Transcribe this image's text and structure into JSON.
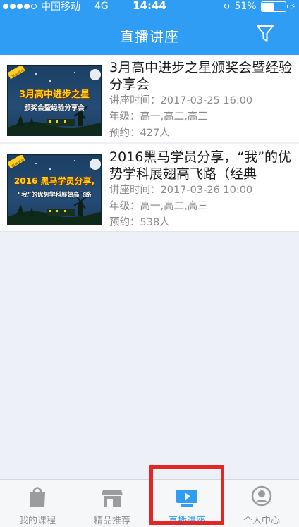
{
  "status": {
    "carrier": "中国移动",
    "network": "4G",
    "time": "14:44",
    "battery": "51%",
    "battery_level": 0.51
  },
  "header": {
    "title": "直播讲座"
  },
  "lectures": [
    {
      "title": "3月高中进步之星颁奖会暨经验分享会",
      "time": "讲座时间：2017-03-25 16:00",
      "grade": "年级：高一,高二,高三",
      "booked": "预约：427人",
      "thumb": {
        "tag": "高中学员",
        "line1": "3月高中进步之星",
        "line2": "颁奖会暨经验分享会"
      }
    },
    {
      "title": "2016黑马学员分享，“我”的优势学科展翅高飞路（经典",
      "time": "讲座时间：2017-03-26 10:00",
      "grade": "年级：高一,高二,高三",
      "booked": "预约：538人",
      "thumb": {
        "tag": "高中学员",
        "line1": "2016 黑马学员分享,",
        "line2": "“我”的优势学科展翅高飞路"
      }
    }
  ],
  "tabs": [
    {
      "label": "我的课程",
      "icon": "bag-icon"
    },
    {
      "label": "精品推荐",
      "icon": "store-icon"
    },
    {
      "label": "直播讲座",
      "icon": "play-screen-icon",
      "active": true
    },
    {
      "label": "个人中心",
      "icon": "person-icon"
    }
  ],
  "colors": {
    "primary": "#2f9df4",
    "highlight_box": "#e32626"
  }
}
